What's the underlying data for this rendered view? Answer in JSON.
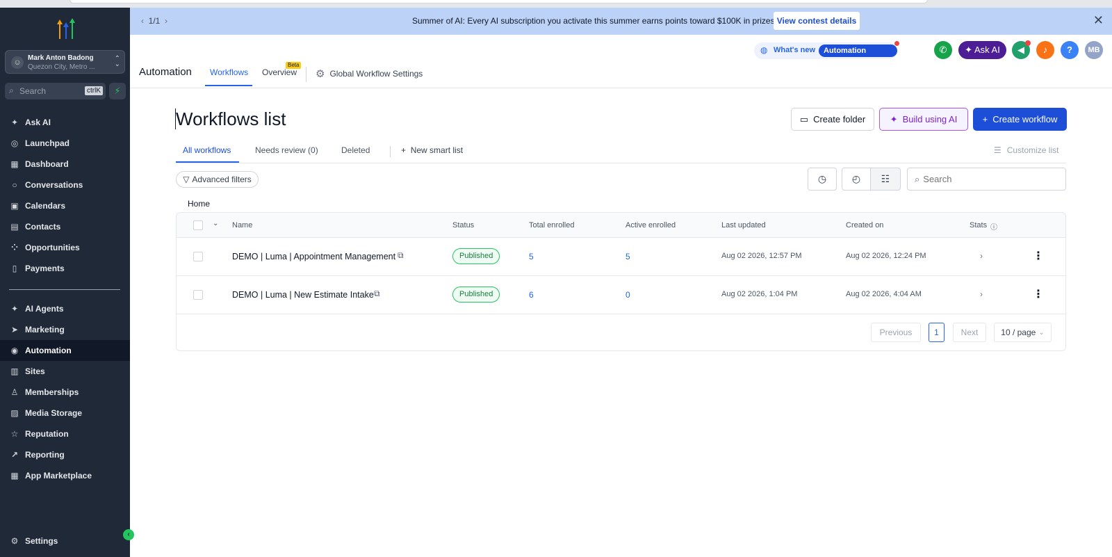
{
  "sidebar": {
    "account": {
      "name": "Mark Anton Badong",
      "location": "Quezon City, Metro ..."
    },
    "search": {
      "placeholder": "Search",
      "shortcut": "ctrlK"
    },
    "items": [
      {
        "label": "Ask AI",
        "icon": "sparkles-icon"
      },
      {
        "label": "Launchpad",
        "icon": "rocket-icon"
      },
      {
        "label": "Dashboard",
        "icon": "grid-icon"
      },
      {
        "label": "Conversations",
        "icon": "chat-icon"
      },
      {
        "label": "Calendars",
        "icon": "calendar-icon"
      },
      {
        "label": "Contacts",
        "icon": "contact-icon"
      },
      {
        "label": "Opportunities",
        "icon": "network-icon"
      },
      {
        "label": "Payments",
        "icon": "receipt-icon"
      }
    ],
    "items2": [
      {
        "label": "AI Agents",
        "icon": "sparkles-icon"
      },
      {
        "label": "Marketing",
        "icon": "send-icon"
      },
      {
        "label": "Automation",
        "icon": "automation-icon",
        "active": true
      },
      {
        "label": "Sites",
        "icon": "sites-icon"
      },
      {
        "label": "Memberships",
        "icon": "badge-icon"
      },
      {
        "label": "Media Storage",
        "icon": "image-icon"
      },
      {
        "label": "Reputation",
        "icon": "star-icon"
      },
      {
        "label": "Reporting",
        "icon": "trend-icon"
      },
      {
        "label": "App Marketplace",
        "icon": "apps-icon"
      }
    ],
    "settings": "Settings"
  },
  "banner": {
    "pager": "1/1",
    "message": "Summer of AI: Every AI subscription you activate this summer earns points toward $100K in prizes.",
    "cta": "View contest details"
  },
  "header": {
    "app_title": "Automation",
    "tabs": [
      {
        "label": "Workflows",
        "active": true
      },
      {
        "label": "Overview",
        "badge": "Beta"
      }
    ],
    "global_settings": "Global Workflow Settings",
    "whats_new": "What's new",
    "automation_updates": "Automation updates",
    "ask_ai": "Ask AI",
    "avatar_initials": "MB",
    "help": "?"
  },
  "page": {
    "title": "Workflows list",
    "buttons": {
      "create_folder": "Create folder",
      "build_ai": "Build using AI",
      "create_workflow": "Create workflow"
    },
    "subtabs": [
      "All workflows",
      "Needs review (0)",
      "Deleted"
    ],
    "new_smart_list": "New smart list",
    "customize_list": "Customize list",
    "advanced_filters": "Advanced filters",
    "search_placeholder": "Search",
    "breadcrumb": "Home"
  },
  "table": {
    "columns": [
      "Name",
      "Status",
      "Total enrolled",
      "Active enrolled",
      "Last updated",
      "Created on",
      "Stats"
    ],
    "rows": [
      {
        "name": "DEMO | Luma | Appointment Management",
        "status": "Published",
        "total": "5",
        "active": "5",
        "updated": "Aug 02 2026, 12:57 PM",
        "created": "Aug 02 2026, 12:24 PM"
      },
      {
        "name": "DEMO | Luma | New Estimate Intake",
        "status": "Published",
        "total": "6",
        "active": "0",
        "updated": "Aug 02 2026, 1:04 PM",
        "created": "Aug 02 2026, 4:04 AM"
      }
    ]
  },
  "pagination": {
    "previous": "Previous",
    "current": "1",
    "next": "Next",
    "page_size": "10 / page"
  },
  "colors": {
    "accent": "#1d4ed8",
    "sidebar": "#1f2937",
    "published": "#22c55e",
    "banner": "#bcd3f7"
  }
}
